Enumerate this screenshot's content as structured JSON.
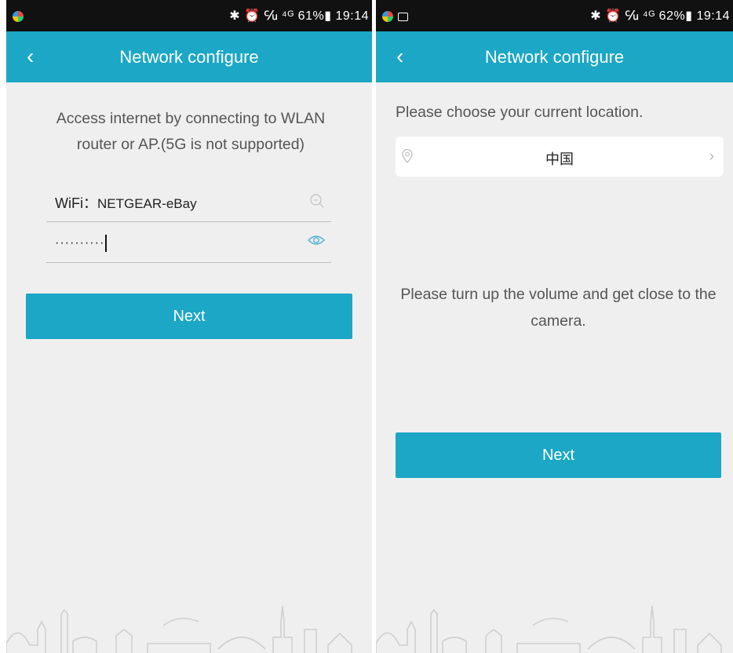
{
  "left_screen": {
    "status": {
      "battery": "61%",
      "time": "19:14",
      "indicators": "✱ ⏰ ℆ ⁴ᴳ 61%▮ 19:14"
    },
    "nav": {
      "title": "Network configure"
    },
    "intro_text": "Access internet by connecting to WLAN router or AP.(5G is not supported)",
    "wifi": {
      "prefix": "WiFi：",
      "ssid": "NETGEAR-eBay"
    },
    "password": {
      "masked_value": "··········"
    },
    "next_label": "Next"
  },
  "right_screen": {
    "status": {
      "battery": "62%",
      "time": "19:14",
      "indicators": "✱ ⏰ ℆ ⁴ᴳ 62%▮ 19:14"
    },
    "nav": {
      "title": "Network configure"
    },
    "location_prompt": "Please choose your current location.",
    "location_value": "中国",
    "volume_text": "Please turn up the volume and get close to the camera.",
    "next_label": "Next"
  },
  "colors": {
    "accent": "#1ba7c5",
    "background": "#efefef",
    "status_bar": "#111111"
  },
  "icons": [
    "back-icon",
    "search-icon",
    "eye-icon",
    "location-pin-icon",
    "chevron-right-icon"
  ]
}
